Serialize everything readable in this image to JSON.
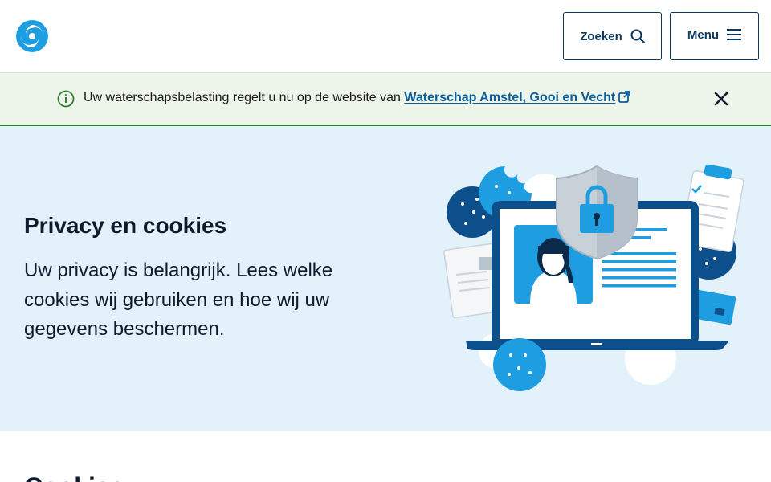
{
  "header": {
    "search_label": "Zoeken",
    "menu_label": "Menu"
  },
  "notice": {
    "text": "Uw waterschapsbelasting regelt u nu op de website van ",
    "link_text": "Waterschap Amstel, Gooi en Vecht"
  },
  "hero": {
    "title": "Privacy en cookies",
    "intro": "Uw privacy is belangrijk. Lees welke cookies wij gebruiken en hoe wij uw gegevens beschermen."
  },
  "section": {
    "heading": "Cookies"
  },
  "colors": {
    "brand_blue": "#1e9ee0",
    "dark_blue": "#0b3a5e",
    "hero_bg": "#e3f1fa",
    "notice_bg": "#edf4e9",
    "notice_border": "#2e7d32",
    "link": "#0b5e99"
  },
  "icons": {
    "logo": "swirl-logo",
    "search": "search-icon",
    "menu": "hamburger-icon",
    "info": "info-icon",
    "external": "external-link-icon",
    "close": "close-icon"
  }
}
